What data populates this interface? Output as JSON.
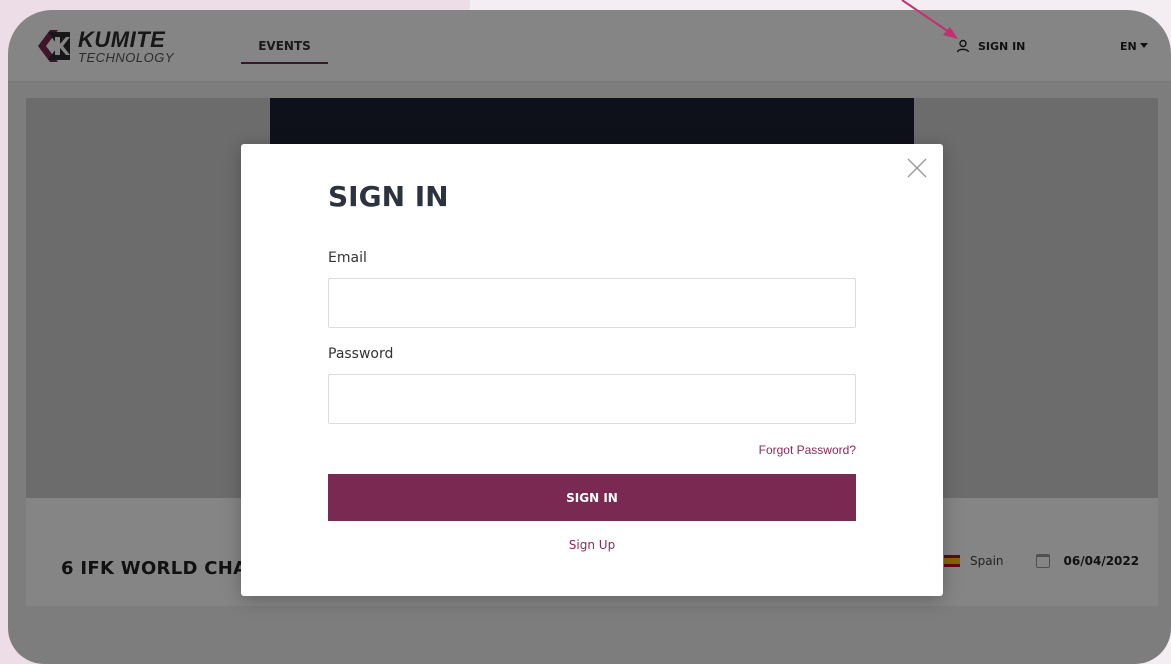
{
  "brand": {
    "name": "KUMITE",
    "sub": "TECHNOLOGY",
    "accent": "#7a2a52"
  },
  "nav": {
    "events_label": "EVENTS",
    "signin_label": "SIGN IN",
    "signin_icon": "user-icon",
    "lang_label": "EN",
    "lang_icon": "caret-down-icon"
  },
  "event": {
    "title": "6 IFK WORLD CHA",
    "country": "Spain",
    "date": "06/04/2022"
  },
  "modal": {
    "title": "SIGN IN",
    "email_label": "Email",
    "email_value": "",
    "password_label": "Password",
    "password_value": "",
    "forgot_label": "Forgot Password?",
    "submit_label": "SIGN IN",
    "signup_label": "Sign Up",
    "close_icon": "close-icon"
  }
}
